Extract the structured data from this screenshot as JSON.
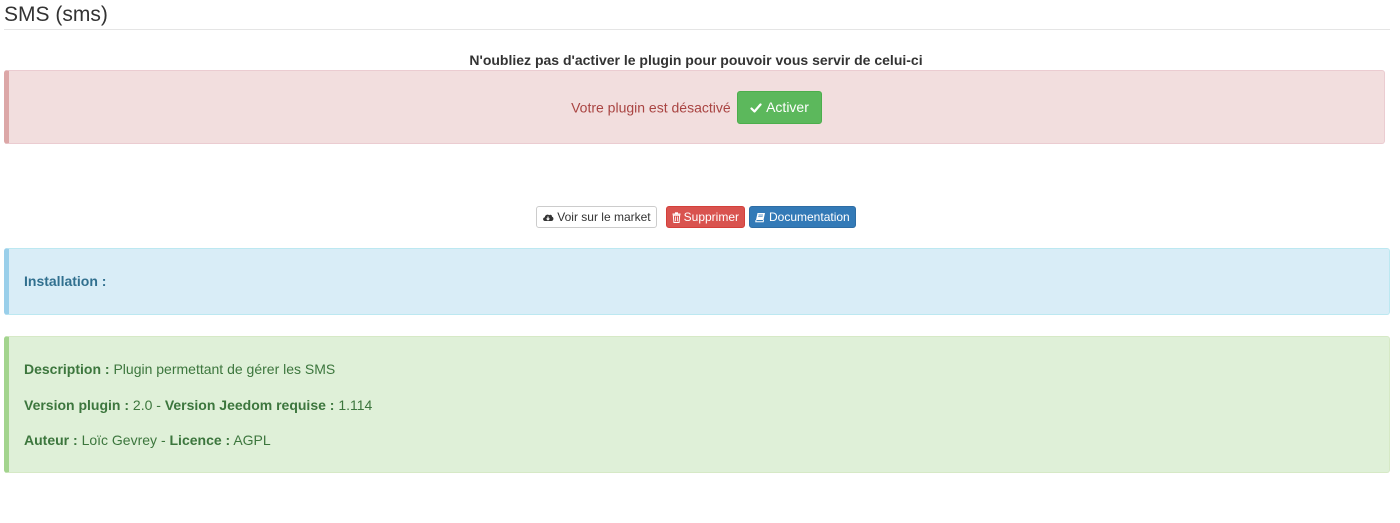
{
  "page": {
    "title": "SMS (sms)"
  },
  "notice": "N'oubliez pas d'activer le plugin pour pouvoir vous servir de celui-ci",
  "status_alert": {
    "message": "Votre plugin est désactivé",
    "activate_label": "Activer"
  },
  "actions": {
    "market_label": "Voir sur le market",
    "delete_label": "Supprimer",
    "doc_label": "Documentation"
  },
  "installation": {
    "label": "Installation :"
  },
  "info": {
    "description_label": "Description :",
    "description_value": "Plugin permettant de gérer les SMS",
    "version_plugin_label": "Version plugin :",
    "version_plugin_value": "2.0",
    "separator": "-",
    "version_jeedom_label": "Version Jeedom requise :",
    "version_jeedom_value": "1.114",
    "author_label": "Auteur :",
    "author_value": "Loïc Gevrey",
    "license_label": "Licence :",
    "license_value": "AGPL"
  },
  "icons": {
    "activate": "check-icon",
    "market": "cloud-download-icon",
    "delete": "trash-icon",
    "doc": "book-icon"
  },
  "colors": {
    "success": "#5cb85c",
    "danger": "#d9534f",
    "primary": "#337ab7",
    "danger_text": "#a94442",
    "info_text": "#31708f",
    "success_text": "#3c763d"
  }
}
